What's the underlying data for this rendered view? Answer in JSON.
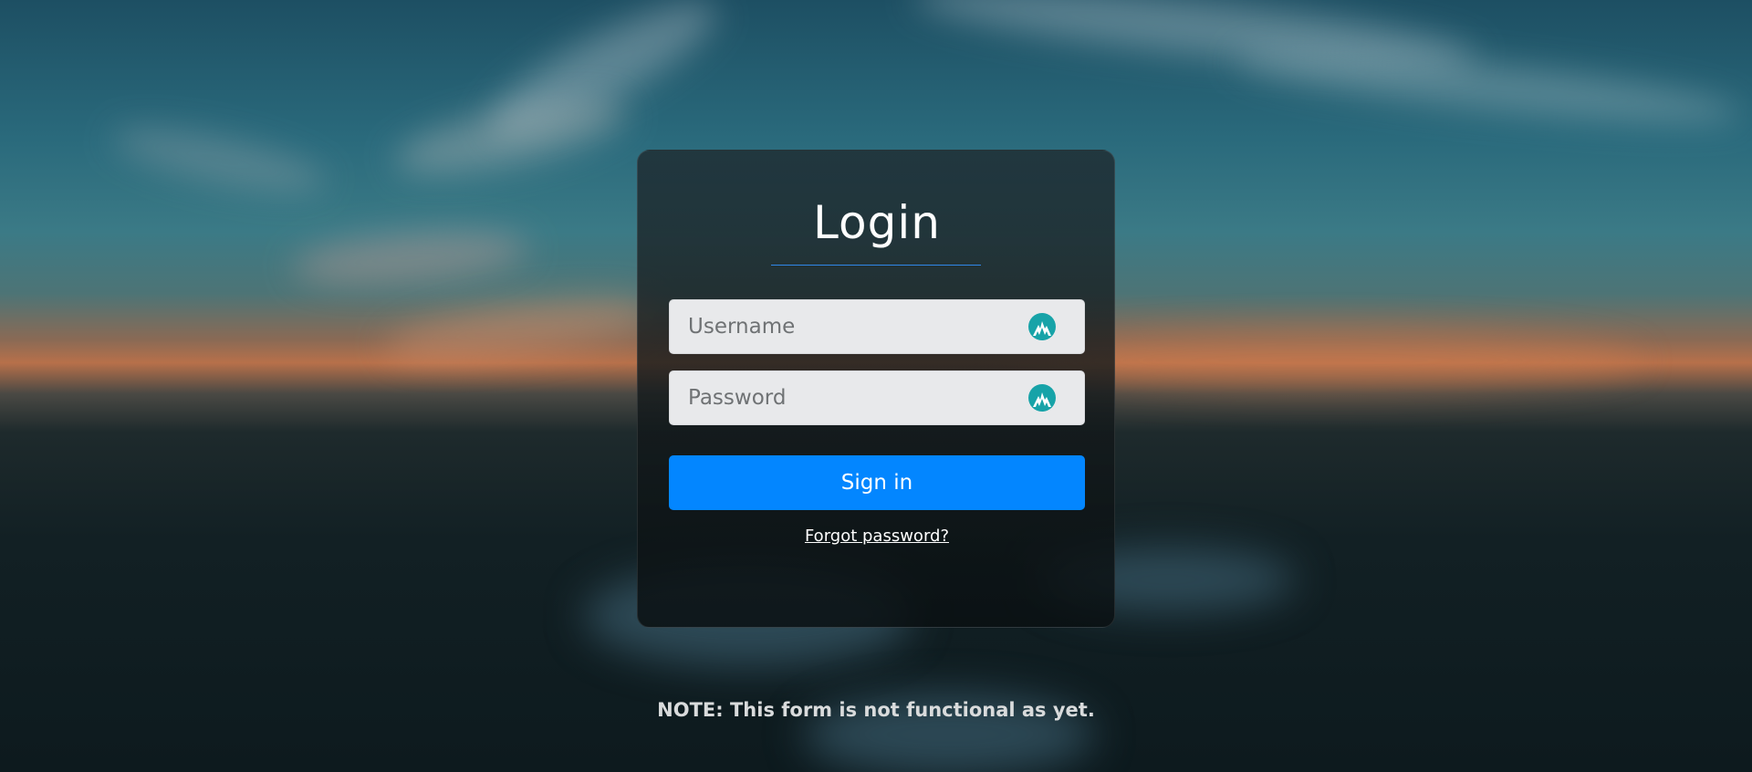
{
  "login": {
    "title": "Login",
    "username": {
      "placeholder": "Username",
      "icon": "password-manager-icon"
    },
    "password": {
      "placeholder": "Password",
      "icon": "password-manager-icon"
    },
    "signin_label": "Sign in",
    "forgot_label": "Forgot password?"
  },
  "note": "NOTE: This form is not functional as yet.",
  "colors": {
    "accent": "#0386ff",
    "title_rule": "#2f86e8",
    "icon": "#17a3a8"
  }
}
